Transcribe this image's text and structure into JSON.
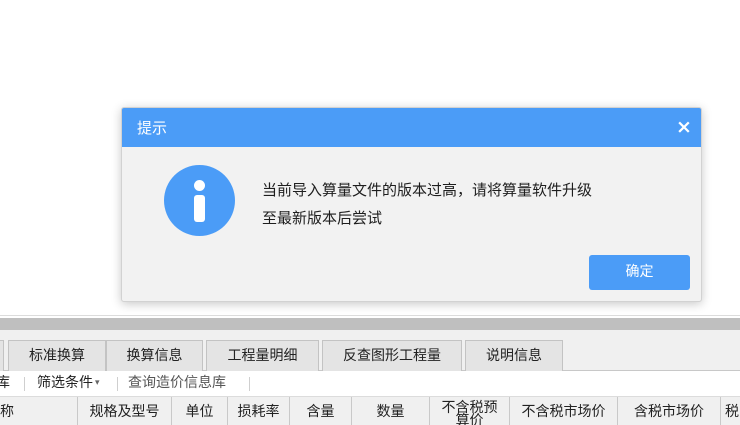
{
  "dialog": {
    "title": "提示",
    "close_glyph": "×",
    "message_line1": "当前导入算量文件的版本过高，请将算量软件升级",
    "message_line2": "至最新版本后尝试",
    "ok_label": "确定",
    "accent_color": "#4b9cf7"
  },
  "tabs": [
    {
      "label": "标准换算"
    },
    {
      "label": "换算信息"
    },
    {
      "label": "工程量明细"
    },
    {
      "label": "反查图形工程量"
    },
    {
      "label": "说明信息"
    }
  ],
  "toolbar": {
    "partial_label": "库",
    "filter_label": "筛选条件",
    "filter_caret": "▾",
    "query_label": "查询造价信息库"
  },
  "grid": {
    "columns": [
      {
        "label": "称"
      },
      {
        "label": "规格及型号"
      },
      {
        "label": "单位"
      },
      {
        "label": "损耗率"
      },
      {
        "label": "含量"
      },
      {
        "label": "数量"
      },
      {
        "label": "不含税预算价"
      },
      {
        "label": "不含税市场价"
      },
      {
        "label": "含税市场价"
      },
      {
        "label": "税"
      }
    ]
  }
}
